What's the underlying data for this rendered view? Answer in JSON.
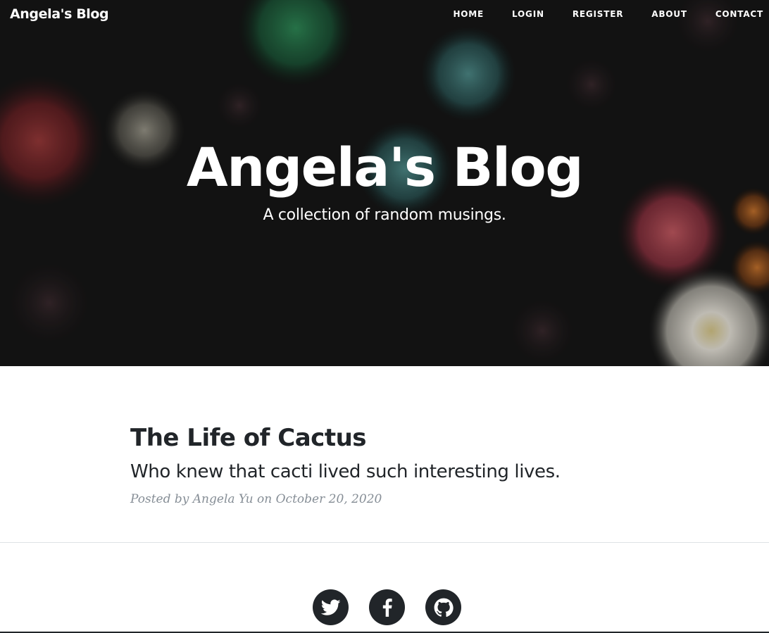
{
  "navbar": {
    "brand": "Angela's Blog",
    "links": [
      {
        "label": "HOME"
      },
      {
        "label": "LOGIN"
      },
      {
        "label": "REGISTER"
      },
      {
        "label": "ABOUT"
      },
      {
        "label": "CONTACT"
      }
    ]
  },
  "hero": {
    "heading": "Angela's Blog",
    "subheading": "A collection of random musings."
  },
  "posts": [
    {
      "title": "The Life of Cactus",
      "subtitle": "Who knew that cacti lived such interesting lives.",
      "meta_prefix": "Posted by ",
      "author": "Angela Yu",
      "meta_on": " on ",
      "date": "October 20, 2020"
    }
  ],
  "footer": {
    "social": [
      {
        "icon": "twitter-icon"
      },
      {
        "icon": "facebook-icon"
      },
      {
        "icon": "github-icon"
      }
    ]
  },
  "colors": {
    "text_dark": "#212529",
    "meta_gray": "#868e96",
    "divider": "#dee2e6",
    "white": "#ffffff"
  }
}
